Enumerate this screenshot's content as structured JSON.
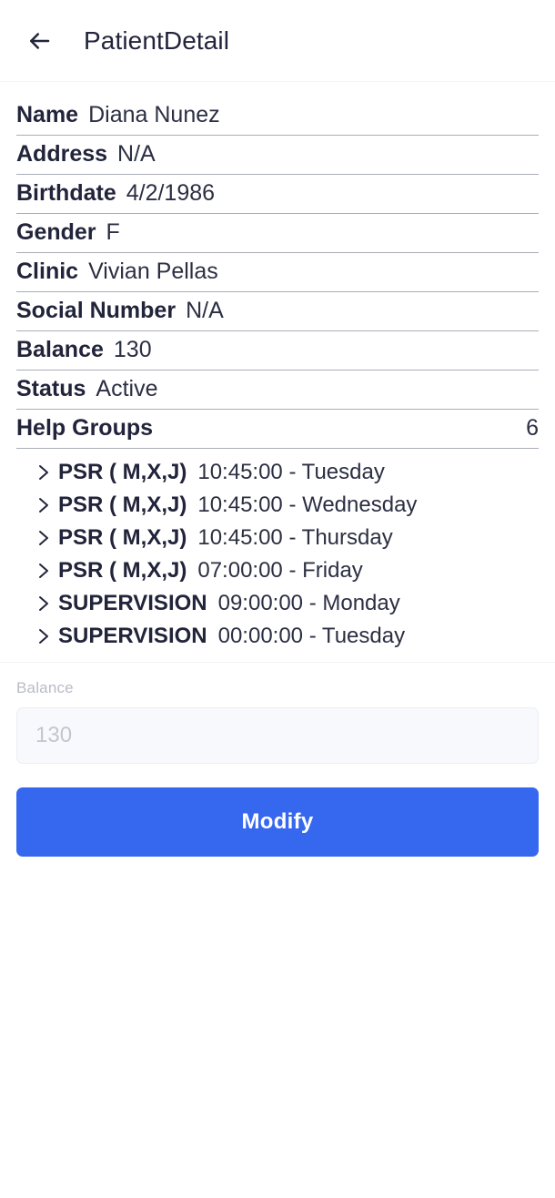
{
  "header": {
    "title": "PatientDetail",
    "back_icon": "arrow-left-icon"
  },
  "details": [
    {
      "label": "Name",
      "value": "Diana  Nunez"
    },
    {
      "label": "Address",
      "value": "N/A"
    },
    {
      "label": "Birthdate",
      "value": "4/2/1986"
    },
    {
      "label": "Gender",
      "value": "F"
    },
    {
      "label": "Clinic",
      "value": "Vivian Pellas"
    },
    {
      "label": "Social Number",
      "value": "N/A"
    },
    {
      "label": "Balance",
      "value": "130"
    },
    {
      "label": "Status",
      "value": "Active"
    }
  ],
  "help_groups": {
    "label": "Help Groups",
    "count": "6",
    "chevron_icon": "chevron-right-icon",
    "items": [
      {
        "name": "PSR ( M,X,J)",
        "schedule": "10:45:00 - Tuesday"
      },
      {
        "name": "PSR ( M,X,J)",
        "schedule": "10:45:00 - Wednesday"
      },
      {
        "name": "PSR ( M,X,J)",
        "schedule": "10:45:00 - Thursday"
      },
      {
        "name": "PSR ( M,X,J)",
        "schedule": "07:00:00 - Friday"
      },
      {
        "name": "SUPERVISION",
        "schedule": "09:00:00 - Monday"
      },
      {
        "name": "SUPERVISION",
        "schedule": "00:00:00 - Tuesday"
      }
    ]
  },
  "balance_field": {
    "label": "Balance",
    "value": "",
    "placeholder": "130"
  },
  "actions": {
    "modify_label": "Modify"
  },
  "colors": {
    "accent": "#3668ef",
    "text_primary": "#21243a",
    "text_muted": "#b9bcc6",
    "divider": "#aaaeb8"
  }
}
